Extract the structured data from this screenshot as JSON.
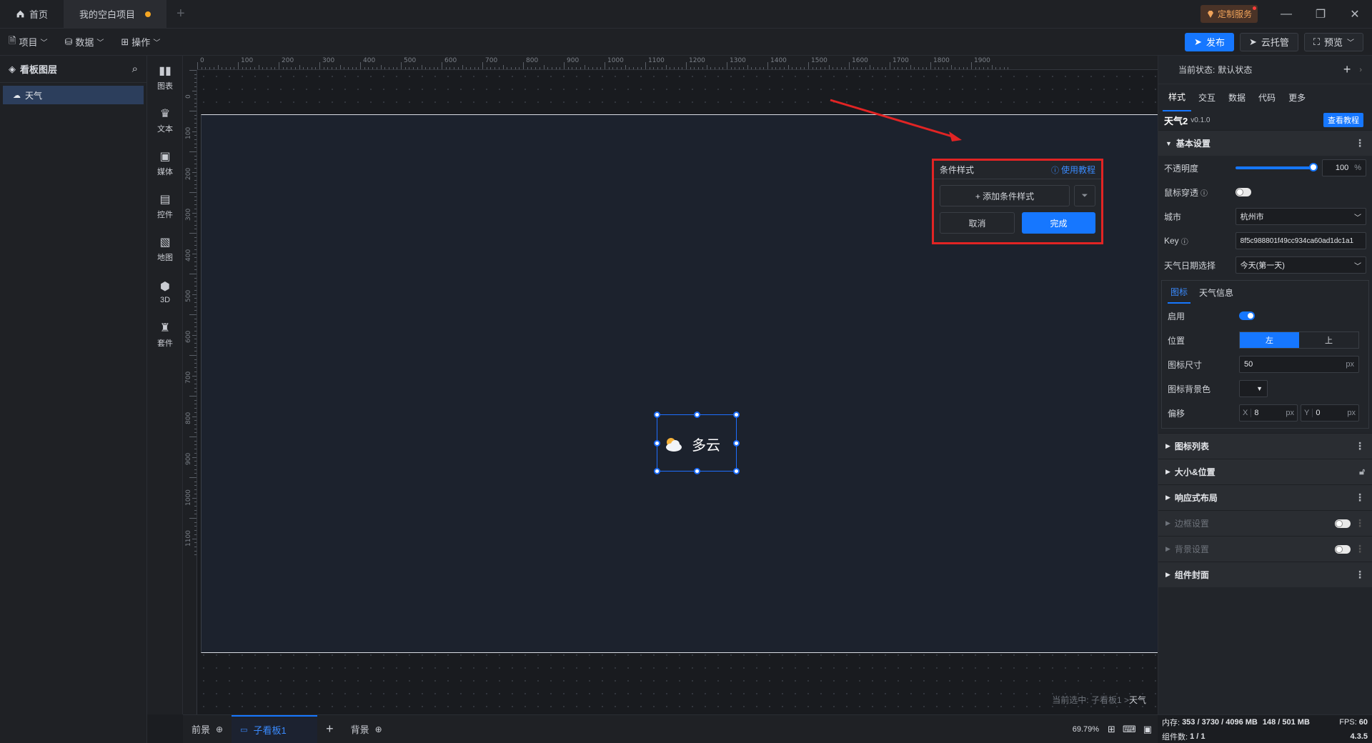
{
  "titlebar": {
    "home_tab": "首页",
    "project_tab": "我的空白项目",
    "custom_service": "定制服务"
  },
  "menubar": {
    "project": "项目",
    "data": "数据",
    "operate": "操作",
    "publish": "发布",
    "cloud": "云托管",
    "preview": "预览"
  },
  "layers": {
    "title": "看板图层",
    "items": [
      "天气"
    ]
  },
  "tools": [
    {
      "label": "图表",
      "icon": "chart-icon"
    },
    {
      "label": "文本",
      "icon": "text-icon"
    },
    {
      "label": "媒体",
      "icon": "media-icon"
    },
    {
      "label": "控件",
      "icon": "control-icon"
    },
    {
      "label": "地图",
      "icon": "map-icon"
    },
    {
      "label": "3D",
      "icon": "cube-icon"
    },
    {
      "label": "套件",
      "icon": "kit-icon"
    }
  ],
  "ruler": {
    "top": [
      "0",
      "100",
      "200",
      "300",
      "400",
      "500",
      "600",
      "700",
      "800",
      "900",
      "1000",
      "1100",
      "1200",
      "1300",
      "1400",
      "1500",
      "1600",
      "1700",
      "1800",
      "1900"
    ],
    "left": [
      "0",
      "100",
      "200",
      "300",
      "400",
      "500",
      "600",
      "700",
      "800",
      "900",
      "1000",
      "1100"
    ]
  },
  "widget": {
    "text": "多云",
    "icon": "partly-cloudy-icon"
  },
  "condition_popup": {
    "title": "条件样式",
    "help": "使用教程",
    "add": "+ 添加条件样式",
    "cancel": "取消",
    "done": "完成"
  },
  "canvas": {
    "breadcrumb_prefix": "当前选中: 子看板1 > ",
    "breadcrumb_current": "天气"
  },
  "bottombar": {
    "foreground": "前景",
    "subboard": "子看板1",
    "background": "背景",
    "zoom": "69.79%"
  },
  "rightpanel": {
    "state_label": "当前状态:",
    "state_value": "默认状态",
    "tabs": [
      "样式",
      "交互",
      "数据",
      "代码",
      "更多"
    ],
    "component_name": "天气2",
    "version": "v0.1.0",
    "tutorial": "查看教程",
    "basic_settings": "基本设置",
    "opacity_label": "不透明度",
    "opacity_value": "100",
    "opacity_unit": "%",
    "mouse_through_label": "鼠标穿透",
    "city_label": "城市",
    "city_value": "杭州市",
    "key_label": "Key",
    "key_value": "8f5c988801f49cc934ca60ad1dc1a1",
    "date_label": "天气日期选择",
    "date_value": "今天(第一天)",
    "subtabs": [
      "图标",
      "天气信息"
    ],
    "enable_label": "启用",
    "position_label": "位置",
    "position_left": "左",
    "position_top": "上",
    "icon_size_label": "图标尺寸",
    "icon_size_value": "50",
    "unit_px": "px",
    "icon_bg_label": "图标背景色",
    "offset_label": "偏移",
    "offset_x_label": "X",
    "offset_x": "8",
    "offset_y_label": "Y",
    "offset_y": "0",
    "sections": [
      {
        "label": "图标列表",
        "dim": false,
        "tail": "menu"
      },
      {
        "label": "大小&位置",
        "dim": false,
        "tail": "lock"
      },
      {
        "label": "响应式布局",
        "dim": false,
        "tail": "menu"
      },
      {
        "label": "边框设置",
        "dim": true,
        "tail": "toggle"
      },
      {
        "label": "背景设置",
        "dim": true,
        "tail": "toggle"
      },
      {
        "label": "组件封面",
        "dim": false,
        "tail": "menu"
      }
    ]
  },
  "status": {
    "memory_label": "内存:",
    "memory_value": "353 / 3730 / 4096 MB",
    "memory_value2": "148 / 501 MB",
    "fps_label": "FPS:",
    "fps_value": "60",
    "components_label": "组件数:",
    "components_value": "1 / 1",
    "version": "4.3.5"
  },
  "colors": {
    "accent": "#1677ff",
    "highlight_border": "#e12424",
    "board_bg": "#1c222d"
  }
}
